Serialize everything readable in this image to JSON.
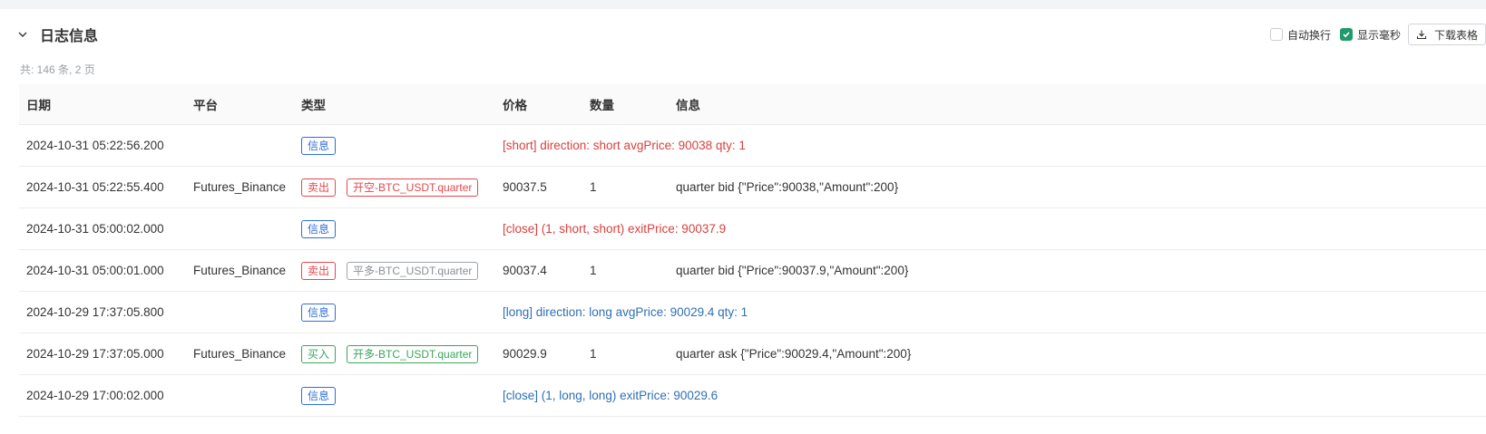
{
  "header": {
    "title": "日志信息"
  },
  "toolbar": {
    "auto_wrap_label": "自动换行",
    "auto_wrap_checked": false,
    "show_ms_label": "显示毫秒",
    "show_ms_checked": true,
    "download_label": "下载表格"
  },
  "summary": "共: 146 条, 2 页",
  "columns": {
    "date": "日期",
    "platform": "平台",
    "type": "类型",
    "price": "价格",
    "quantity": "数量",
    "info": "信息"
  },
  "rows": [
    {
      "date": "2024-10-31 05:22:56.200",
      "platform": "",
      "type": "信息",
      "type_kind": "info",
      "order": "",
      "order_kind": "",
      "price": "",
      "quantity": "",
      "info": "[short] direction: short avgPrice: 90038 qty: 1",
      "info_color": "red",
      "info_span": true
    },
    {
      "date": "2024-10-31 05:22:55.400",
      "platform": "Futures_Binance",
      "type": "卖出",
      "type_kind": "sell",
      "order": "开空-BTC_USDT.quarter",
      "order_kind": "sell",
      "price": "90037.5",
      "quantity": "1",
      "info": "quarter bid {\"Price\":90038,\"Amount\":200}",
      "info_color": "default",
      "info_span": false
    },
    {
      "date": "2024-10-31 05:00:02.000",
      "platform": "",
      "type": "信息",
      "type_kind": "info",
      "order": "",
      "order_kind": "",
      "price": "",
      "quantity": "",
      "info": "[close] (1, short, short) exitPrice: 90037.9",
      "info_color": "red",
      "info_span": true
    },
    {
      "date": "2024-10-31 05:00:01.000",
      "platform": "Futures_Binance",
      "type": "卖出",
      "type_kind": "sell",
      "order": "平多-BTC_USDT.quarter",
      "order_kind": "gray",
      "price": "90037.4",
      "quantity": "1",
      "info": "quarter bid {\"Price\":90037.9,\"Amount\":200}",
      "info_color": "default",
      "info_span": false
    },
    {
      "date": "2024-10-29 17:37:05.800",
      "platform": "",
      "type": "信息",
      "type_kind": "info",
      "order": "",
      "order_kind": "",
      "price": "",
      "quantity": "",
      "info": "[long] direction: long avgPrice: 90029.4 qty: 1",
      "info_color": "blue",
      "info_span": true
    },
    {
      "date": "2024-10-29 17:37:05.000",
      "platform": "Futures_Binance",
      "type": "买入",
      "type_kind": "buy",
      "order": "开多-BTC_USDT.quarter",
      "order_kind": "buy",
      "price": "90029.9",
      "quantity": "1",
      "info": "quarter ask {\"Price\":90029.4,\"Amount\":200}",
      "info_color": "default",
      "info_span": false
    },
    {
      "date": "2024-10-29 17:00:02.000",
      "platform": "",
      "type": "信息",
      "type_kind": "info",
      "order": "",
      "order_kind": "",
      "price": "",
      "quantity": "",
      "info": "[close] (1, long, long) exitPrice: 90029.6",
      "info_color": "blue",
      "info_span": true
    }
  ],
  "colors": {
    "info_tag": "#2f6fd6",
    "sell_tag": "#e5484d",
    "buy_tag": "#3aa55d",
    "gray_tag": "#8a8f96",
    "message_red": "#d9403e",
    "message_blue": "#2f6fb5",
    "checkbox_checked": "#1f9a6b"
  },
  "icons": {
    "collapse": "chevron-down-icon",
    "check": "checkmark-icon",
    "download": "download-icon"
  }
}
